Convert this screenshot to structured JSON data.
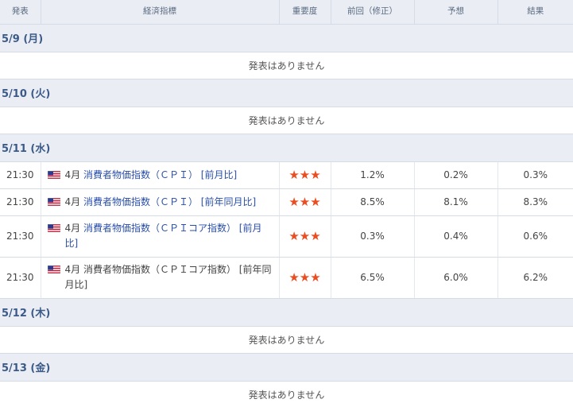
{
  "header": {
    "time": "発表",
    "indicator": "経済指標",
    "importance": "重要度",
    "previous": "前回（修正）",
    "forecast": "予想",
    "result": "結果"
  },
  "no_events_text": "発表はありません",
  "days": [
    {
      "date": "5/9 (月)"
    },
    {
      "date": "5/10 (火)"
    },
    {
      "date": "5/11 (水)"
    },
    {
      "date": "5/12 (木)"
    },
    {
      "date": "5/13 (金)"
    }
  ],
  "events": [
    {
      "time": "21:30",
      "month": "4月",
      "name": "消費者物価指数（ＣＰＩ） [前月比]",
      "linked": true,
      "previous": "1.2%",
      "forecast": "0.2%",
      "result": "0.3%"
    },
    {
      "time": "21:30",
      "month": "4月",
      "name": "消費者物価指数（ＣＰＩ） [前年同月比]",
      "linked": true,
      "previous": "8.5%",
      "forecast": "8.1%",
      "result": "8.3%"
    },
    {
      "time": "21:30",
      "month": "4月",
      "name": "消費者物価指数（ＣＰＩコア指数） [前月比]",
      "linked": true,
      "previous": "0.3%",
      "forecast": "0.4%",
      "result": "0.6%"
    },
    {
      "time": "21:30",
      "month": "4月",
      "name": "消費者物価指数（ＣＰＩコア指数） [前年同月比]",
      "linked": false,
      "previous": "6.5%",
      "forecast": "6.0%",
      "result": "6.2%"
    }
  ],
  "importance_stars": "★★★",
  "country_flag": "us-flag-icon",
  "colors": {
    "header_bg": "#eaeef4",
    "date_text": "#3c5a88",
    "link": "#2a4fa8",
    "star": "#e94d20"
  }
}
